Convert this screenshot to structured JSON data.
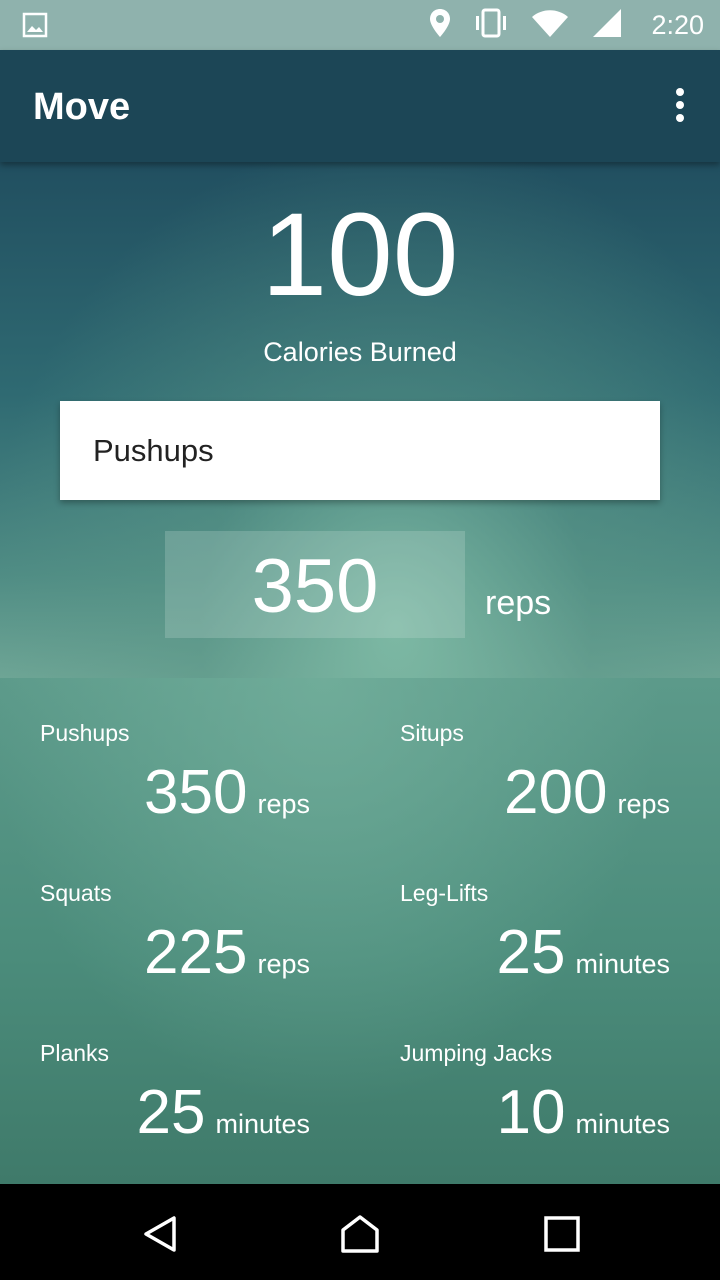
{
  "status_bar": {
    "time": "2:20",
    "icons": [
      "image-icon",
      "location-icon",
      "vibrate-icon",
      "wifi-icon",
      "signal-icon"
    ]
  },
  "app_bar": {
    "title": "Move",
    "overflow_icon": "more-vert-icon"
  },
  "hero": {
    "calories_value": "100",
    "calories_label": "Calories Burned",
    "selected_exercise": "Pushups",
    "reps_value": "350",
    "reps_unit": "reps"
  },
  "stats": [
    {
      "name": "Pushups",
      "value": "350",
      "unit": "reps"
    },
    {
      "name": "Situps",
      "value": "200",
      "unit": "reps"
    },
    {
      "name": "Squats",
      "value": "225",
      "unit": "reps"
    },
    {
      "name": "Leg-Lifts",
      "value": "25",
      "unit": "minutes"
    },
    {
      "name": "Planks",
      "value": "25",
      "unit": "minutes"
    },
    {
      "name": "Jumping Jacks",
      "value": "10",
      "unit": "minutes"
    }
  ],
  "nav_bar": {
    "icons": [
      "back-icon",
      "home-icon",
      "recents-icon"
    ]
  },
  "colors": {
    "status_bar": "#8fb2ad",
    "app_bar": "#1c4656",
    "hero_top": "#214f60",
    "stats_bg": "#4b8c7b"
  }
}
